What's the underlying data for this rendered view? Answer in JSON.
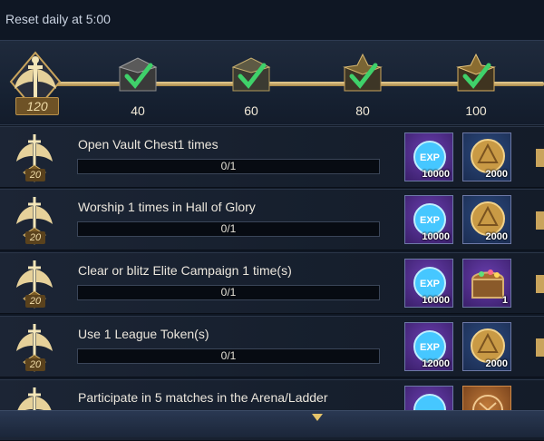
{
  "header": {
    "reset_text": "Reset daily at 5:00"
  },
  "activity": {
    "current": "120",
    "milestones": [
      {
        "value": "40",
        "claimed": true
      },
      {
        "value": "60",
        "claimed": true
      },
      {
        "value": "80",
        "claimed": true
      },
      {
        "value": "100",
        "claimed": true
      }
    ]
  },
  "quests": [
    {
      "points": "20",
      "title": "Open Vault Chest1 times",
      "progress": "0/1",
      "rewards": [
        {
          "icon": "exp-crystal-icon",
          "qty": "10000",
          "style": "purple"
        },
        {
          "icon": "gold-coin-icon",
          "qty": "2000",
          "style": "blue"
        }
      ]
    },
    {
      "points": "20",
      "title": "Worship 1 times in Hall of Glory",
      "progress": "0/1",
      "rewards": [
        {
          "icon": "exp-crystal-icon",
          "qty": "10000",
          "style": "purple"
        },
        {
          "icon": "gold-coin-icon",
          "qty": "2000",
          "style": "blue"
        }
      ]
    },
    {
      "points": "20",
      "title": "Clear or blitz Elite Campaign 1 time(s)",
      "progress": "0/1",
      "rewards": [
        {
          "icon": "exp-crystal-icon",
          "qty": "10000",
          "style": "purple"
        },
        {
          "icon": "treasure-chest-icon",
          "qty": "1",
          "style": "purple"
        }
      ]
    },
    {
      "points": "20",
      "title": "Use 1 League Token(s)",
      "progress": "0/1",
      "rewards": [
        {
          "icon": "exp-crystal-icon",
          "qty": "12000",
          "style": "purple"
        },
        {
          "icon": "gold-coin-icon",
          "qty": "2000",
          "style": "blue"
        }
      ]
    },
    {
      "points": "",
      "title": "Participate in 5 matches in the Arena/Ladder",
      "progress": "",
      "rewards": [
        {
          "icon": "exp-crystal-icon",
          "qty": "",
          "style": "purple"
        },
        {
          "icon": "arena-emblem-icon",
          "qty": "",
          "style": "orange"
        }
      ]
    }
  ],
  "colors": {
    "accent_gold": "#c9a45c",
    "check_green": "#3fd16a",
    "exp_blue": "#46c7ff"
  }
}
